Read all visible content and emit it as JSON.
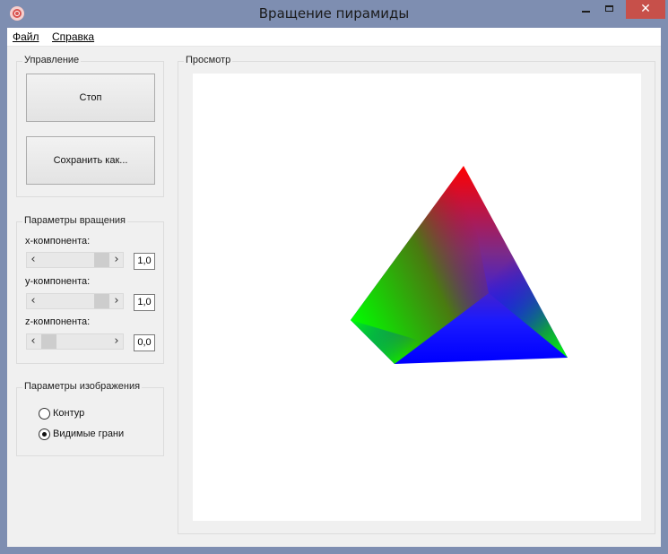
{
  "window": {
    "title": "Вращение пирамиды",
    "close_glyph": "✕"
  },
  "menu": [
    {
      "label": "Файл"
    },
    {
      "label": "Справка"
    }
  ],
  "control": {
    "legend": "Управление",
    "stop_label": "Стоп",
    "save_label": "Сохранить как..."
  },
  "rotation": {
    "legend": "Параметры вращения",
    "x": {
      "label": "x-компонента:",
      "value": "1,0",
      "arrow_left": "‹",
      "arrow_right": "›"
    },
    "y": {
      "label": "y-компонента:",
      "value": "1,0",
      "arrow_left": "‹",
      "arrow_right": "›"
    },
    "z": {
      "label": "z-компонента:",
      "value": "0,0",
      "arrow_left": "‹",
      "arrow_right": "›"
    }
  },
  "image": {
    "legend": "Параметры изображения",
    "options": [
      {
        "label": "Контур",
        "checked": false
      },
      {
        "label": "Видимые грани",
        "checked": true
      }
    ]
  },
  "preview": {
    "legend": "Просмотр"
  },
  "colors": {
    "red": "#ff0000",
    "green": "#00ff00",
    "blue": "#0000ff",
    "canvas": "#ffffff"
  }
}
